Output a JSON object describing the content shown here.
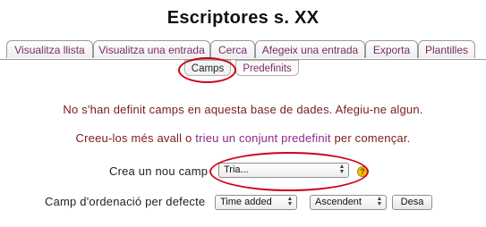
{
  "page": {
    "title": "Escriptores s. XX"
  },
  "tabs": [
    {
      "label": "Visualitza llista"
    },
    {
      "label": "Visualitza una entrada"
    },
    {
      "label": "Cerca"
    },
    {
      "label": "Afegeix una entrada"
    },
    {
      "label": "Exporta"
    },
    {
      "label": "Plantilles"
    }
  ],
  "subtabs": [
    {
      "label": "Camps",
      "active": true
    },
    {
      "label": "Predefinits",
      "active": false
    }
  ],
  "messages": {
    "no_fields": "No s'han definit camps en aquesta base de dades. Afegiu-ne algun.",
    "create_prefix": "Creeu-los més avall o",
    "create_link": "trieu un conjunt predefinit",
    "create_suffix": "per començar."
  },
  "new_field": {
    "label": "Crea un nou camp",
    "select_value": "Tria...",
    "help_icon": "help-icon"
  },
  "sort": {
    "label": "Camp d'ordenació per defecte",
    "field_value": "Time added",
    "order_value": "Ascendent",
    "save_label": "Desa"
  },
  "colors": {
    "tab_text": "#7b2a6b",
    "message_text": "#7a1a1a",
    "link_text": "#8a2a8a",
    "highlight_ellipse": "#d0001a"
  }
}
